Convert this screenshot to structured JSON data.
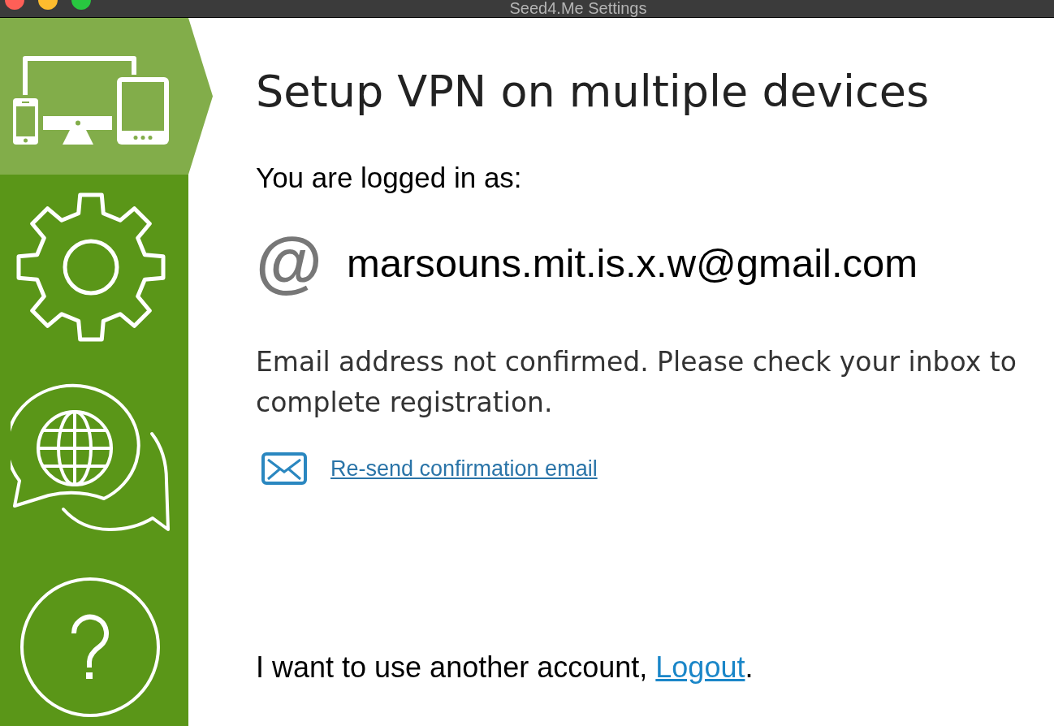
{
  "window": {
    "title": "Seed4.Me Settings"
  },
  "sidebar": {
    "items": [
      {
        "kind": "devices",
        "selected": true
      },
      {
        "kind": "settings",
        "selected": false
      },
      {
        "kind": "support",
        "selected": false
      },
      {
        "kind": "help",
        "selected": false
      }
    ]
  },
  "main": {
    "heading": "Setup VPN on multiple devices",
    "logged_in_label": "You are logged in as:",
    "account_icon": "@",
    "account_email": "marsouns.mit.is.x.w@gmail.com",
    "notice": "Email address not confirmed. Please check your inbox to complete registration.",
    "resend_link": "Re-send confirmation email",
    "footer": {
      "text": "I want to use another account,",
      "link": "Logout",
      "end": "."
    }
  }
}
